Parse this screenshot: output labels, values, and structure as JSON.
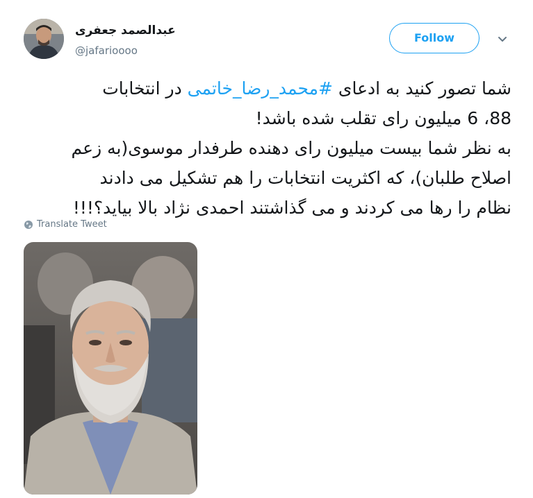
{
  "user": {
    "display_name": "عبدالصمد جعفری",
    "handle": "@jafarioooo"
  },
  "follow_label": "Follow",
  "tweet": {
    "line1_prefix": "شما تصور کنید به ادعای ",
    "hashtag": "#محمد_رضا_خاتمی",
    "line1_suffix": " در انتخابات",
    "line2": "88، 6 میلیون رای تقلب شده باشد!",
    "line3": "به نظر شما بیست میلیون رای دهنده طرفدار موسوی(به زعم",
    "line4": "اصلاح طلبان)، که اکثریت انتخابات را هم تشکیل می دادند",
    "line5": "نظام را رها می کردند و می گذاشتند احمدی نژاد بالا بیاید؟!!!"
  },
  "translate_label": "Translate Tweet",
  "colors": {
    "accent": "#1da1f2",
    "text": "#14171a",
    "secondary": "#657786"
  },
  "icons": [
    "avatar",
    "chevron-down-icon",
    "globe-icon",
    "tweet-photo"
  ]
}
